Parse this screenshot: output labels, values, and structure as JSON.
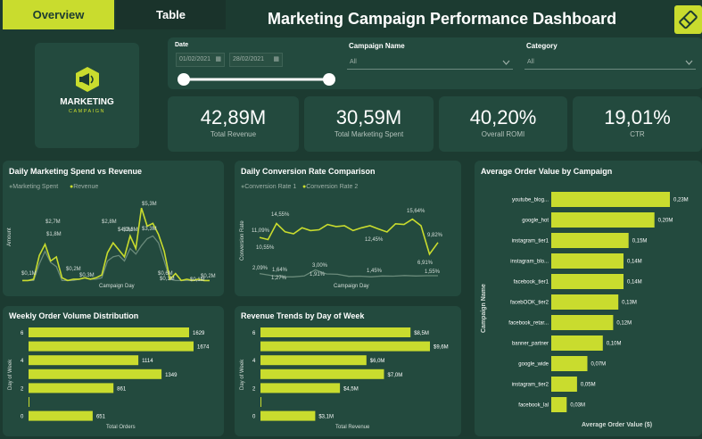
{
  "tabs": [
    {
      "label": "Overview"
    },
    {
      "label": "Table"
    }
  ],
  "title": "Marketing Campaign Performance Dashboard",
  "logo": {
    "line1": "MARKETING",
    "line2": "CAMPAIGN"
  },
  "filters": {
    "date_label": "Date",
    "date_start": "01/02/2021",
    "date_end": "28/02/2021",
    "campaign_label": "Campaign Name",
    "campaign_value": "All",
    "category_label": "Category",
    "category_value": "All"
  },
  "kpis": [
    {
      "value": "42,89M",
      "label": "Total Revenue"
    },
    {
      "value": "30,59M",
      "label": "Total Marketing Spent"
    },
    {
      "value": "40,20%",
      "label": "Overall ROMI"
    },
    {
      "value": "19,01%",
      "label": "CTR"
    }
  ],
  "colors": {
    "accent": "#c9dc2e",
    "background": "#1c3b31",
    "card": "#234a3e",
    "series_gray": "#6a8a7a"
  },
  "charts": {
    "spend_revenue": {
      "title": "Daily Marketing Spend vs Revenue",
      "legend1": "Marketing Spent",
      "legend2": "Revenue",
      "xlabel": "Campaign Day",
      "ylabel": "Amount"
    },
    "conversion": {
      "title": "Daily Conversion Rate Comparison",
      "legend1": "Conversion Rate 1",
      "legend2": "Conversion Rate 2",
      "xlabel": "Campaign Day",
      "ylabel": "Conversion Rate"
    },
    "aov": {
      "title": "Average Order Value by Campaign",
      "xlabel": "Average Order Value ($)",
      "ylabel": "Campaign Name"
    },
    "weekly": {
      "title": "Weekly Order Volume Distribution",
      "xlabel": "Total Orders",
      "ylabel": "Day of Week"
    },
    "revenue_day": {
      "title": "Revenue Trends by Day of Week",
      "xlabel": "Total Revenue",
      "ylabel": "Day of Week"
    }
  },
  "chart_data": [
    {
      "type": "line",
      "title": "Daily Marketing Spend vs Revenue",
      "xlabel": "Campaign Day",
      "ylabel": "Amount",
      "series": [
        {
          "name": "Marketing Spent",
          "values": [
            0.1,
            0.1,
            0.1,
            1.3,
            2.2,
            1.4,
            1.1,
            0.1,
            0.1,
            0.1,
            0.2,
            0.3,
            0.2,
            0.2,
            0.3,
            1.5,
            1.8,
            1.9,
            1.5,
            2.4,
            2.0,
            2.6,
            3.1,
            3.3,
            2.8,
            1.5,
            0.2,
            0.1,
            0.1,
            0.1,
            0.1,
            0.1,
            0.1,
            0.1
          ]
        },
        {
          "name": "Revenue",
          "values": [
            0.1,
            0.1,
            0.2,
            1.9,
            2.7,
            1.5,
            1.8,
            0.3,
            0.1,
            0.2,
            0.2,
            0.3,
            0.2,
            0.3,
            0.5,
            2.1,
            2.8,
            2.3,
            1.8,
            3.3,
            2.4,
            5.3,
            4.0,
            4.2,
            3.4,
            2.2,
            0.2,
            0.6,
            0.1,
            0.2,
            0.1,
            0.2,
            0.1,
            0.1
          ]
        }
      ],
      "data_labels": [
        "$0,1M",
        "$2,7M",
        "$1,8M",
        "$0,2M",
        "$0,3M",
        "$2,8M",
        "$2,3M",
        "$5,3M",
        "$3,3M",
        "$4,0M",
        "$0,6M",
        "$0,1M",
        "$0,1M",
        "$0,2M"
      ]
    },
    {
      "type": "line",
      "title": "Daily Conversion Rate Comparison",
      "xlabel": "Campaign Day",
      "ylabel": "Conversion Rate",
      "series": [
        {
          "name": "Conversion Rate 1",
          "values": [
            2.09,
            1.64,
            1.3,
            1.27,
            1.5,
            3.0,
            2.0,
            1.91,
            1.4,
            1.45,
            1.3,
            1.5,
            1.45,
            1.6,
            1.5,
            1.55,
            1.55
          ]
        },
        {
          "name": "Conversion Rate 2",
          "values": [
            11.09,
            10.55,
            14.55,
            12.5,
            12.0,
            13.5,
            12.8,
            13.0,
            14.3,
            13.8,
            14.0,
            12.8,
            13.5,
            14.0,
            13.2,
            12.45,
            14.5,
            14.3,
            15.64,
            14.0,
            6.91,
            9.82
          ]
        }
      ],
      "data_labels": [
        "11,09%",
        "10,55%",
        "14,55%",
        "12,45%",
        "15,64%",
        "6,91%",
        "9,82%",
        "2,09%",
        "1,64%",
        "1,27%",
        "3,00%",
        "1,91%",
        "1,45%",
        "1,55%"
      ]
    },
    {
      "type": "bar",
      "title": "Average Order Value by Campaign",
      "xlabel": "Average Order Value ($)",
      "ylabel": "Campaign Name",
      "categories": [
        "youtube_blog...",
        "google_hot",
        "instagram_tier1",
        "instagram_blo...",
        "facebook_tier1",
        "facebOOK_tier2",
        "facebook_retar...",
        "banner_partner",
        "google_wide",
        "instagram_tier2",
        "facebook_lal"
      ],
      "values": [
        0.23,
        0.2,
        0.15,
        0.14,
        0.14,
        0.13,
        0.12,
        0.1,
        0.07,
        0.05,
        0.03
      ],
      "labels": [
        "0,23M",
        "0,20M",
        "0,15M",
        "0,14M",
        "0,14M",
        "0,13M",
        "0,12M",
        "0,10M",
        "0,07M",
        "0,05M",
        "0,03M"
      ]
    },
    {
      "type": "bar",
      "title": "Weekly Order Volume Distribution",
      "xlabel": "Total Orders",
      "ylabel": "Day of Week",
      "ticks": [
        "6",
        "4",
        "2",
        "0"
      ],
      "values": [
        1629,
        1674,
        1114,
        1349,
        861,
        0,
        651
      ],
      "labels": [
        "1629",
        "1674",
        "1114",
        "1349",
        "861",
        "",
        "651"
      ]
    },
    {
      "type": "bar",
      "title": "Revenue Trends by Day of Week",
      "xlabel": "Total Revenue",
      "ylabel": "Day of Week",
      "ticks": [
        "6",
        "4",
        "2",
        "0"
      ],
      "values": [
        8.5,
        9.6,
        6.0,
        7.0,
        4.5,
        0,
        3.1
      ],
      "labels": [
        "$8,5M",
        "$9,6M",
        "$6,0M",
        "$7,0M",
        "$4,5M",
        "",
        "$3,1M"
      ]
    }
  ]
}
